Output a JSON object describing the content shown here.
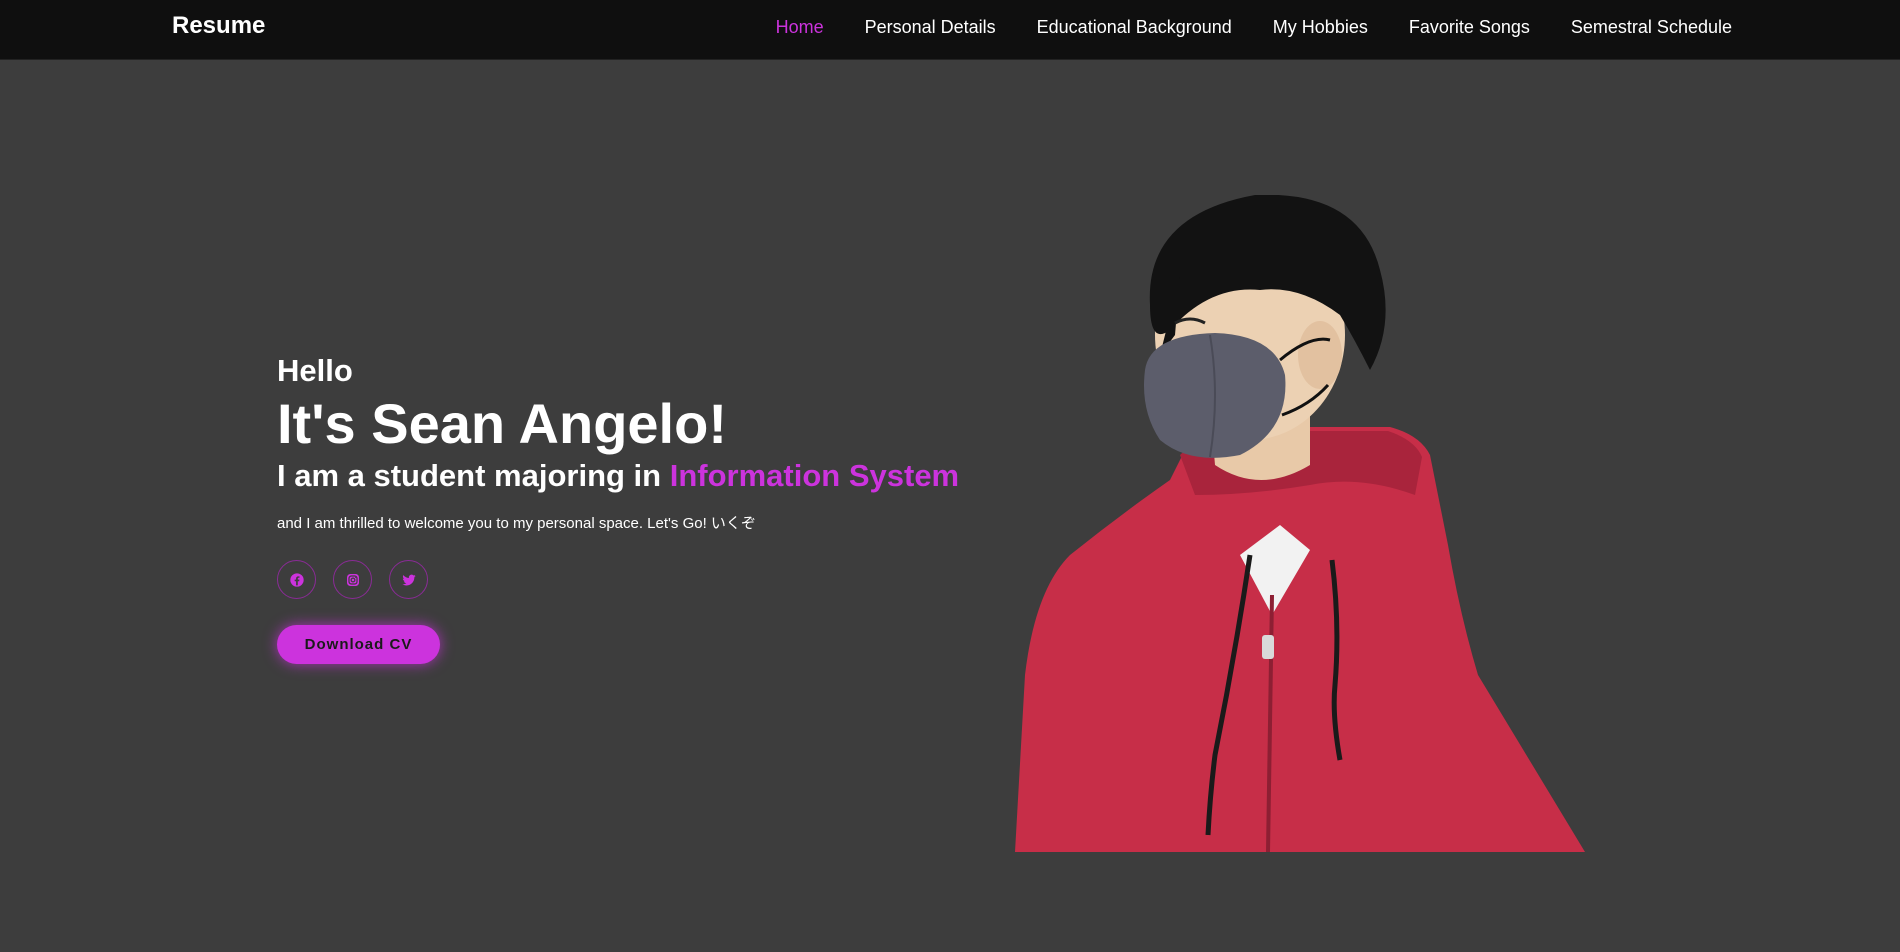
{
  "nav": {
    "brand": "Resume",
    "links": [
      {
        "label": "Home",
        "active": true
      },
      {
        "label": "Personal Details",
        "active": false
      },
      {
        "label": "Educational Background",
        "active": false
      },
      {
        "label": "My Hobbies",
        "active": false
      },
      {
        "label": "Favorite Songs",
        "active": false
      },
      {
        "label": "Semestral Schedule",
        "active": false
      }
    ]
  },
  "hero": {
    "greeting": "Hello",
    "name": "It's Sean Angelo!",
    "tagline_prefix": "I am a student majoring in ",
    "tagline_highlight": "Information System",
    "intro": "and I am thrilled to welcome you to my personal space. Let's Go! いくぞ",
    "socials": [
      {
        "icon": "facebook-icon"
      },
      {
        "icon": "instagram-icon"
      },
      {
        "icon": "twitter-icon"
      }
    ],
    "download_label": "Download CV"
  },
  "colors": {
    "accent": "#cc33dd",
    "background": "#3d3d3d",
    "navbar": "#0f0f0f"
  }
}
